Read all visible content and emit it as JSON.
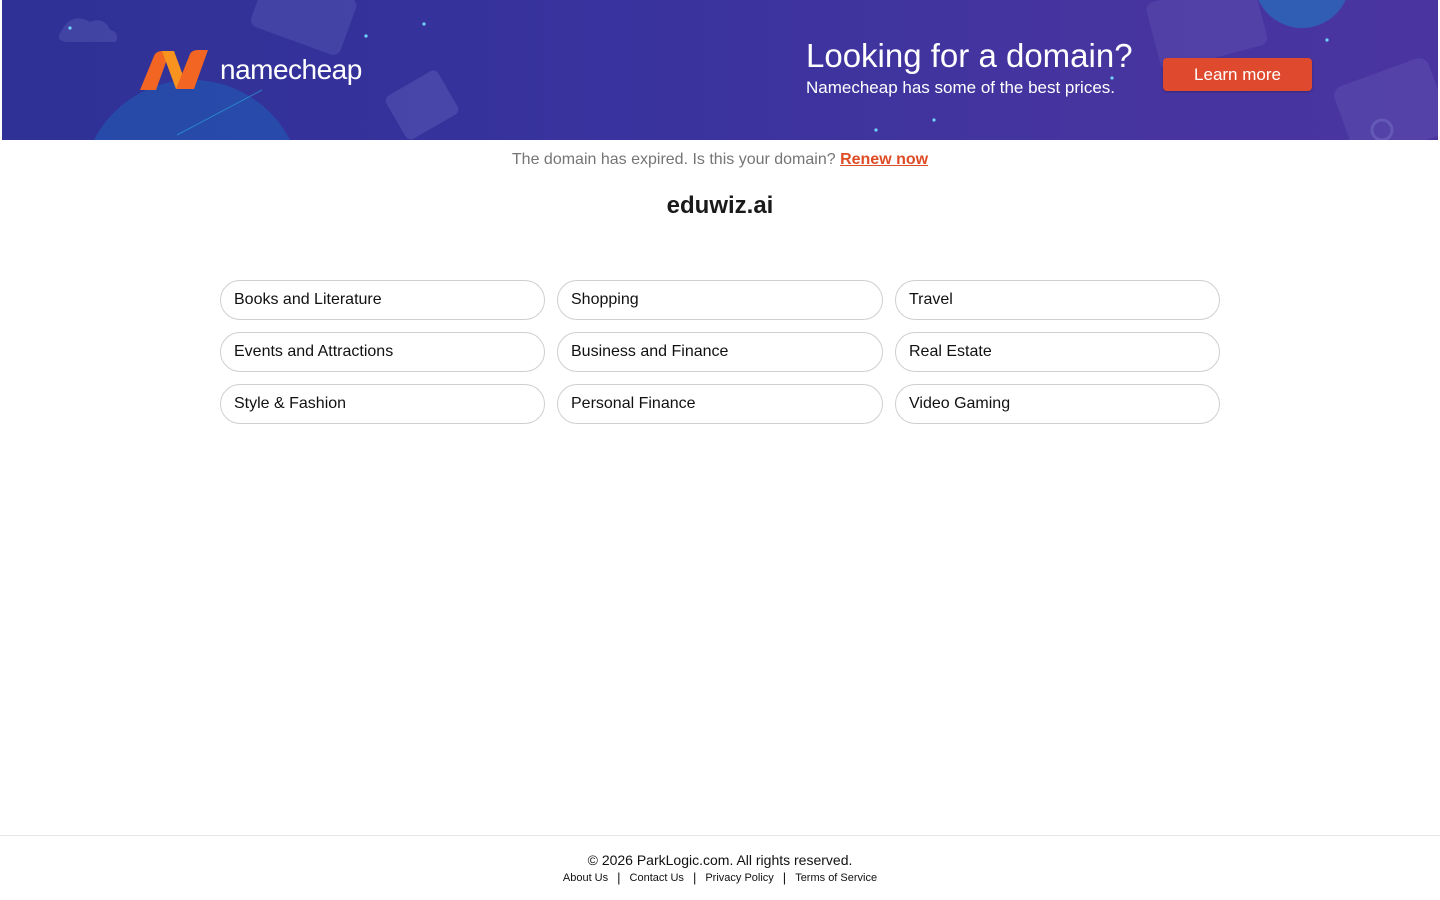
{
  "banner": {
    "logo_text": "namecheap",
    "headline": "Looking for a domain?",
    "subline": "Namecheap has some of the best prices.",
    "cta_label": "Learn more",
    "colors": {
      "background": "#3a339f",
      "accent": "#f26522",
      "cta": "#df4a2e"
    }
  },
  "notice": {
    "text": "The domain has expired. Is this your domain? ",
    "link_label": "Renew now"
  },
  "domain_name": "eduwiz.ai",
  "categories": [
    "Books and Literature",
    "Shopping",
    "Travel",
    "Events and Attractions",
    "Business and Finance",
    "Real Estate",
    "Style & Fashion",
    "Personal Finance",
    "Video Gaming"
  ],
  "footer": {
    "copyright": "© 2026 ParkLogic.com. All rights reserved.",
    "links": [
      "About Us",
      "Contact Us",
      "Privacy Policy",
      "Terms of Service"
    ]
  }
}
